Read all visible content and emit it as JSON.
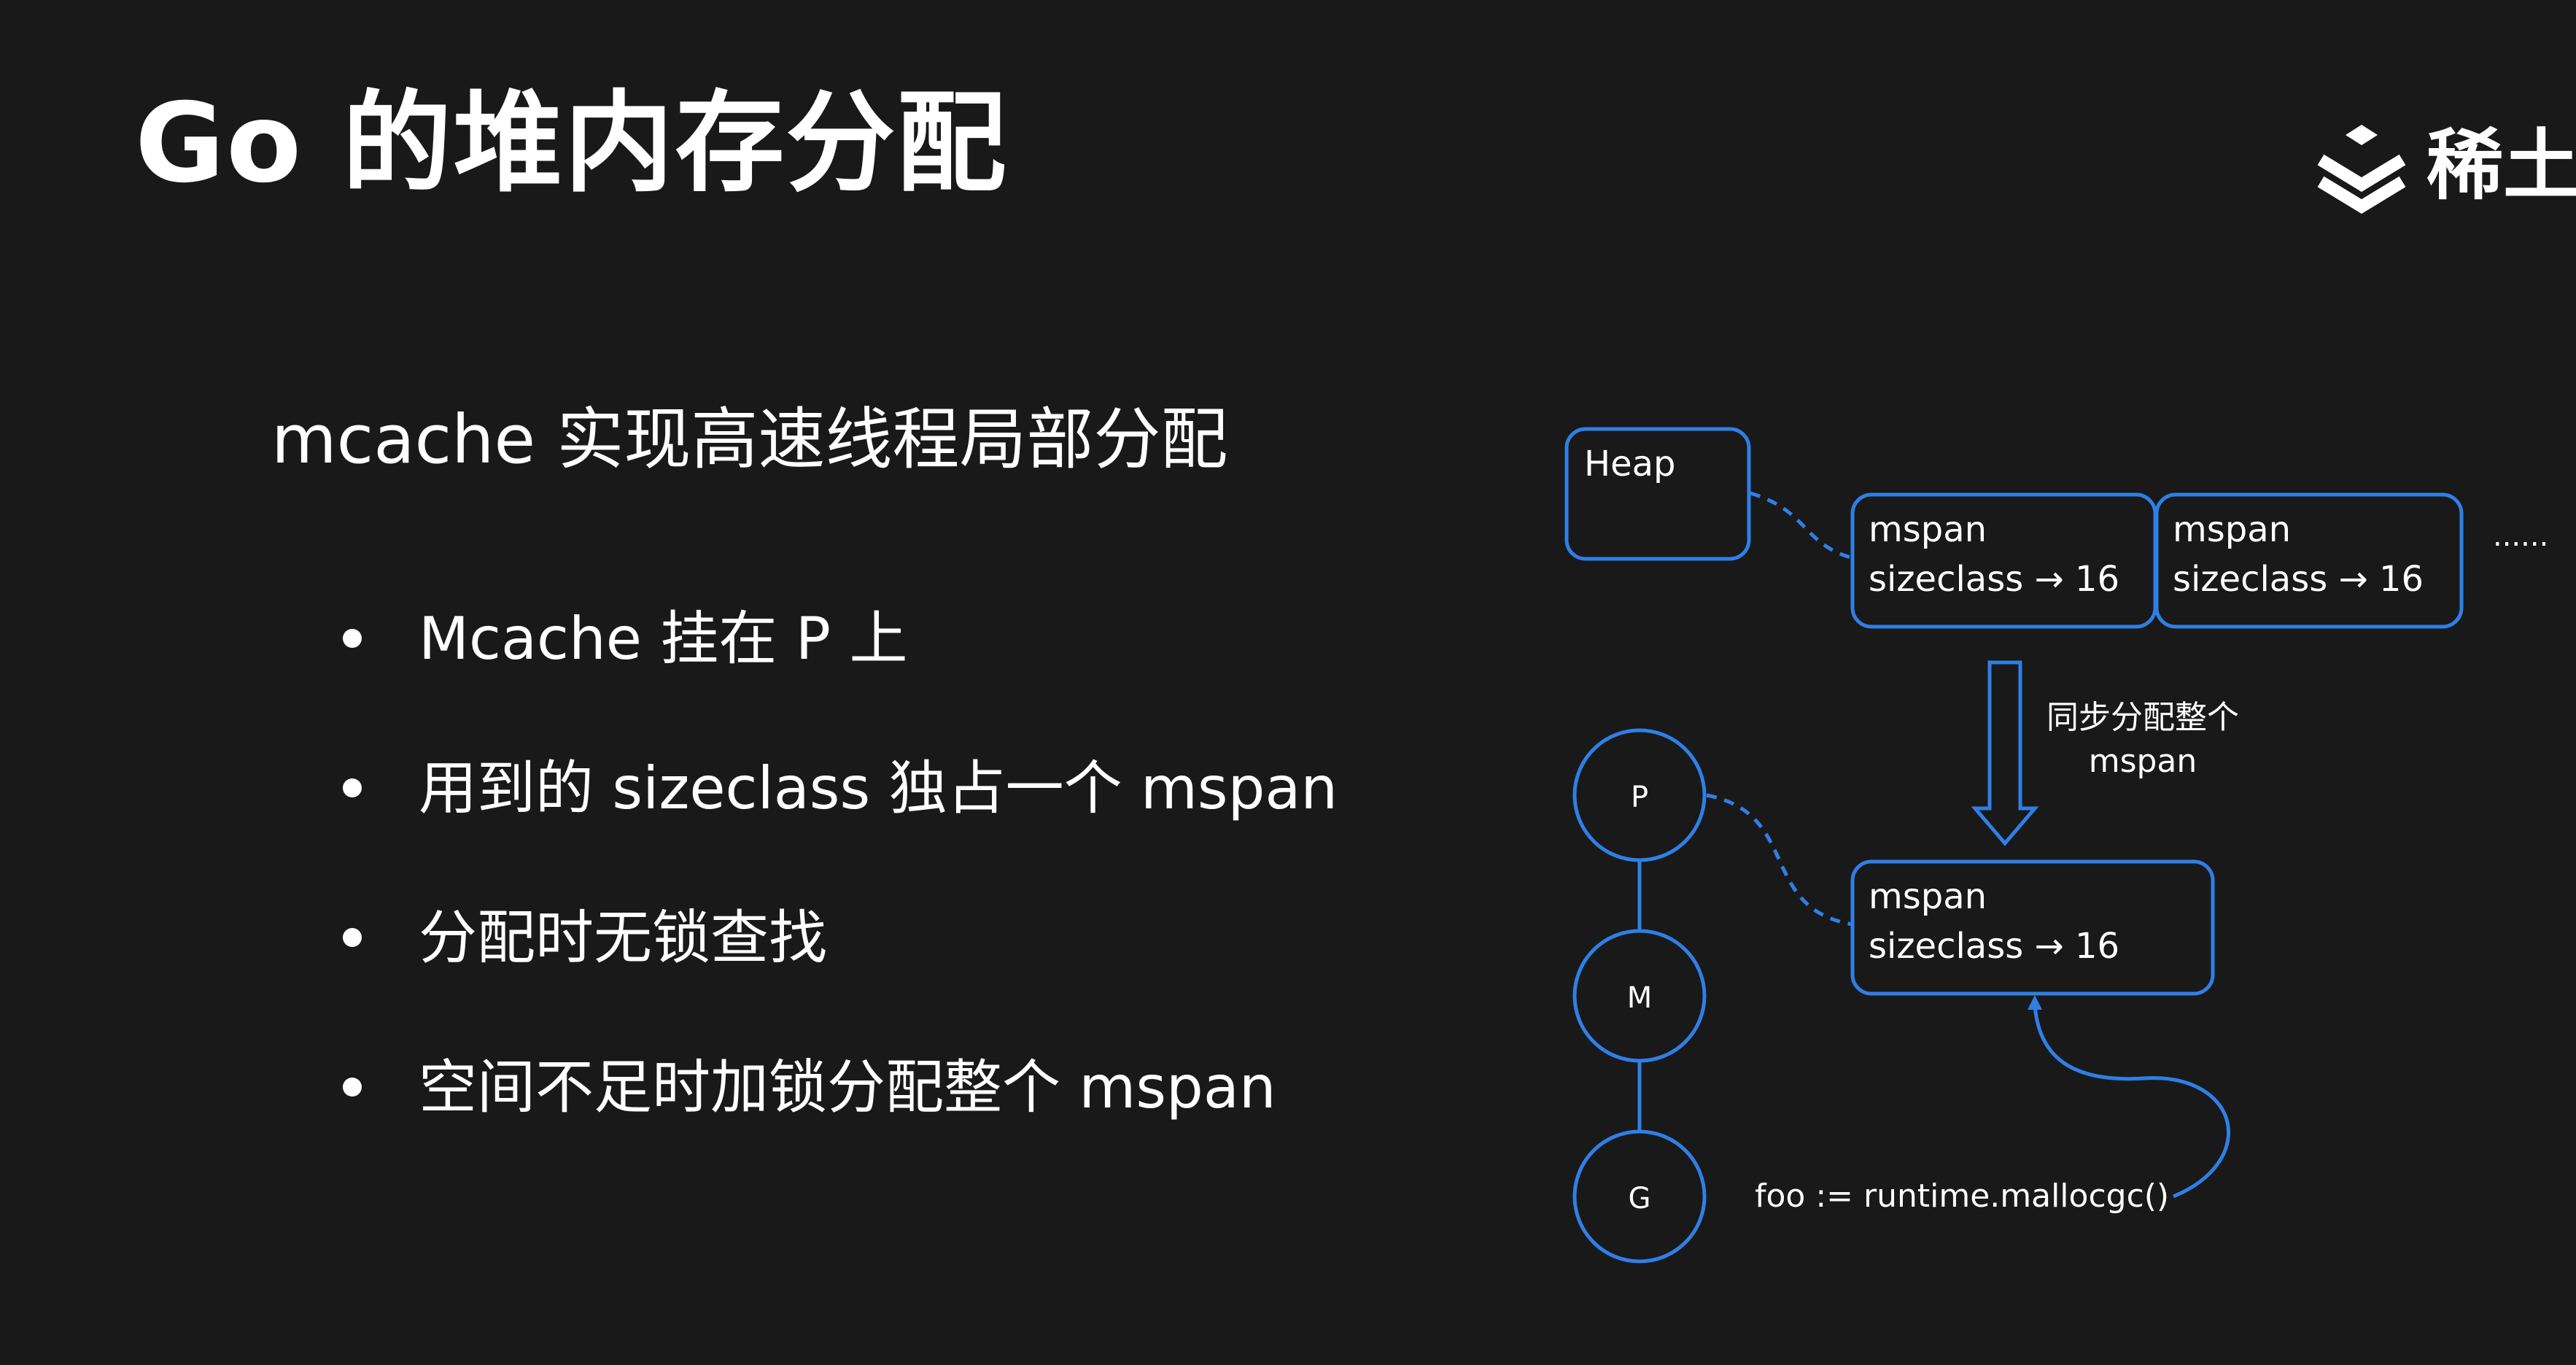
{
  "title": "Go 的堆内存分配",
  "logo": {
    "icon": "juejin-logo-icon",
    "text": "稀土"
  },
  "subtitle": "mcache 实现高速线程局部分配",
  "bullets": [
    "Mcache 挂在 P 上",
    "用到的 sizeclass 独占一个 mspan",
    "分配时无锁查找",
    "空间不足时加锁分配整个 mspan"
  ],
  "diagram": {
    "accent_color": "#2f7fe6",
    "heap_label": "Heap",
    "heap_spans": [
      {
        "line1": "mspan",
        "line2": "sizeclass → 16"
      },
      {
        "line1": "mspan",
        "line2": "sizeclass → 16"
      }
    ],
    "ellipsis": "......",
    "sync_label_line1": "同步分配整个",
    "sync_label_line2": "mspan",
    "local_span": {
      "line1": "mspan",
      "line2": "sizeclass → 16"
    },
    "nodes": [
      "P",
      "M",
      "G"
    ],
    "code": "foo := runtime.mallocgc()"
  }
}
